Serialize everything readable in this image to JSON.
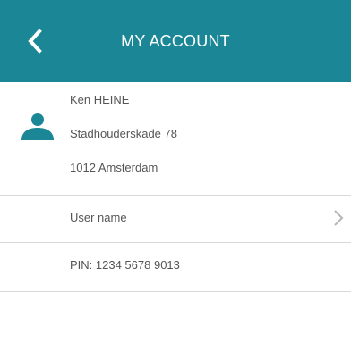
{
  "header": {
    "title": "MY ACCOUNT",
    "back_icon": "chevron-left-icon",
    "background": "#1b8796"
  },
  "address": {
    "avatar_icon": "person-icon",
    "avatar_color": "#1b8796",
    "name": "Ken HEINE",
    "street": "Stadhouderskade 78",
    "city": "1012 Amsterdam"
  },
  "rows": [
    {
      "label": "User name",
      "icon": "chevron-right-icon"
    },
    {
      "label": "PIN: 1234 5678 9013"
    }
  ]
}
